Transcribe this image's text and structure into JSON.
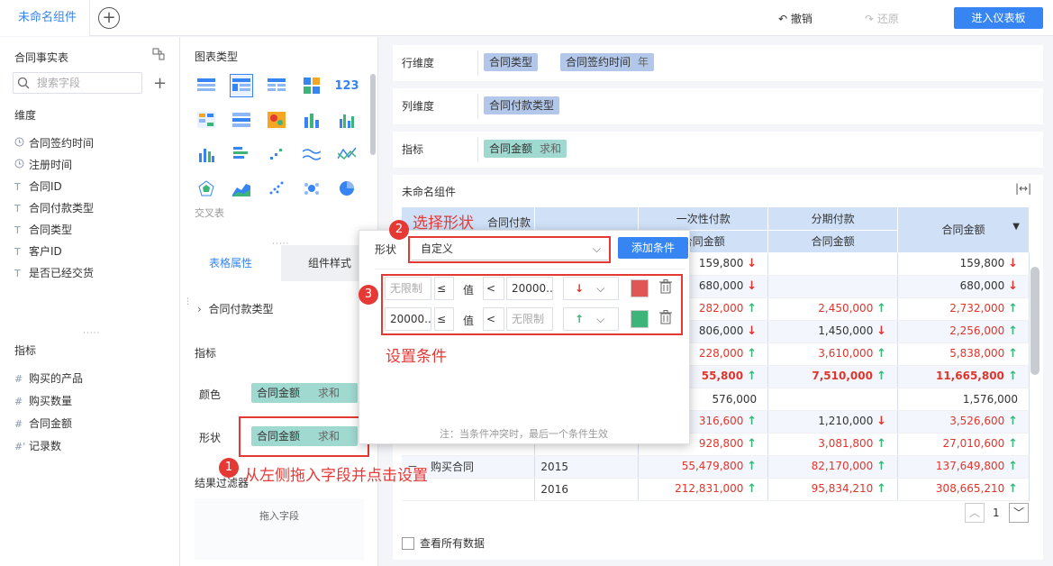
{
  "topbar": {
    "tab_label": "未命名组件",
    "add_label": "+",
    "undo": "撤销",
    "redo": "还原",
    "enter_dashboard": "进入仪表板"
  },
  "left": {
    "dataset": "合同事实表",
    "search_placeholder": "搜索字段",
    "dims_title": "维度",
    "dims": [
      {
        "icon": "clock",
        "label": "合同签约时间"
      },
      {
        "icon": "clock",
        "label": "注册时间"
      },
      {
        "icon": "T",
        "label": "合同ID"
      },
      {
        "icon": "T",
        "label": "合同付款类型"
      },
      {
        "icon": "T",
        "label": "合同类型"
      },
      {
        "icon": "T",
        "label": "客户ID"
      },
      {
        "icon": "T",
        "label": "是否已经交货"
      }
    ],
    "measures_title": "指标",
    "measures": [
      {
        "icon": "#",
        "label": "购买的产品"
      },
      {
        "icon": "#",
        "label": "购买数量"
      },
      {
        "icon": "#",
        "label": "合同金额"
      },
      {
        "icon": "#'",
        "label": "记录数"
      }
    ]
  },
  "mid": {
    "chart_type_title": "图表类型",
    "cross_table_label": "交叉表",
    "tab_table_props": "表格属性",
    "tab_comp_style": "组件样式",
    "group_item": "合同付款类型",
    "indicator_label": "指标",
    "color_label": "颜色",
    "color_field": "合同金额",
    "color_agg": "求和",
    "shape_label": "形状",
    "shape_field": "合同金额",
    "shape_agg": "求和",
    "result_filter": "结果过滤器",
    "drop_hint": "拖入字段"
  },
  "right": {
    "row_dim_label": "行维度",
    "row_dims": [
      {
        "label": "合同类型",
        "sub": ""
      },
      {
        "label": "合同签约时间",
        "sub": "年"
      }
    ],
    "col_dim_label": "列维度",
    "col_dims": [
      {
        "label": "合同付款类型",
        "sub": ""
      }
    ],
    "measure_label": "指标",
    "measures": [
      {
        "label": "合同金额",
        "sub": "求和"
      }
    ],
    "comp_title": "未命名组件",
    "table": {
      "h_col": "合同付款类型",
      "h_g1": "一次性付款",
      "h_g2": "分期付款",
      "h_total": "合同金额",
      "h_sub1": "合同金额",
      "h_sub2": "合同金额",
      "rows": [
        {
          "c1": "159,800",
          "a1": "dn",
          "c2": "",
          "a2": "",
          "t": "159,800",
          "at": "dn"
        },
        {
          "c1": "680,000",
          "a1": "dn",
          "c2": "",
          "a2": "",
          "t": "680,000",
          "at": "dn"
        },
        {
          "c1": "282,000",
          "a1": "up",
          "c2": "2,450,000",
          "a2": "up",
          "t": "2,732,000",
          "at": "up"
        },
        {
          "c1": "806,000",
          "a1": "dn",
          "c2": "1,450,000",
          "a2": "dn",
          "t": "2,256,000",
          "at": "up"
        },
        {
          "c1": "228,000",
          "a1": "up",
          "c2": "3,610,000",
          "a2": "up",
          "t": "5,838,000",
          "at": "up"
        },
        {
          "c1": "55,800",
          "a1": "up",
          "c2": "7,510,000",
          "a2": "up",
          "t": "11,665,800",
          "at": "up"
        },
        {
          "c1": "576,000",
          "a1": "",
          "c2": "",
          "a2": "",
          "t": "1,576,000",
          "at": ""
        },
        {
          "c1": "316,600",
          "a1": "up",
          "c2": "1,210,000",
          "a2": "dn",
          "t": "3,526,600",
          "at": "up"
        },
        {
          "c1": "928,800",
          "a1": "up",
          "c2": "3,081,800",
          "a2": "up",
          "t": "27,010,600",
          "at": "up"
        },
        {
          "c1": "55,479,800",
          "a1": "up",
          "c2": "82,170,000",
          "a2": "up",
          "t": "137,649,800",
          "at": "up"
        },
        {
          "c1": "212,831,000",
          "a1": "up",
          "c2": "95,834,210",
          "a2": "up",
          "t": "308,665,210",
          "at": "up"
        }
      ],
      "row_group": "购买合同",
      "years": [
        "2015",
        "2016"
      ],
      "collapse": "－"
    },
    "page": "1",
    "view_all": "查看所有数据"
  },
  "popup": {
    "shape_label": "形状",
    "select_value": "自定义",
    "add_condition": "添加条件",
    "cond1": {
      "from": "无限制",
      "op1": "≤",
      "value_label": "值",
      "op2": "<",
      "to": "20000...",
      "arrow": "down",
      "color": "#e05555"
    },
    "cond2": {
      "from": "20000...",
      "op1": "≤",
      "value_label": "值",
      "op2": "<",
      "to": "无限制",
      "arrow": "up",
      "color": "#3cb47a"
    },
    "note": "注：当条件冲突时，最后一个条件生效"
  },
  "annotations": {
    "n1": "1",
    "t1": "从左侧拖入字段并点击设置",
    "n2": "2",
    "t2": "选择形状",
    "n3": "3",
    "t3": "设置条件"
  }
}
